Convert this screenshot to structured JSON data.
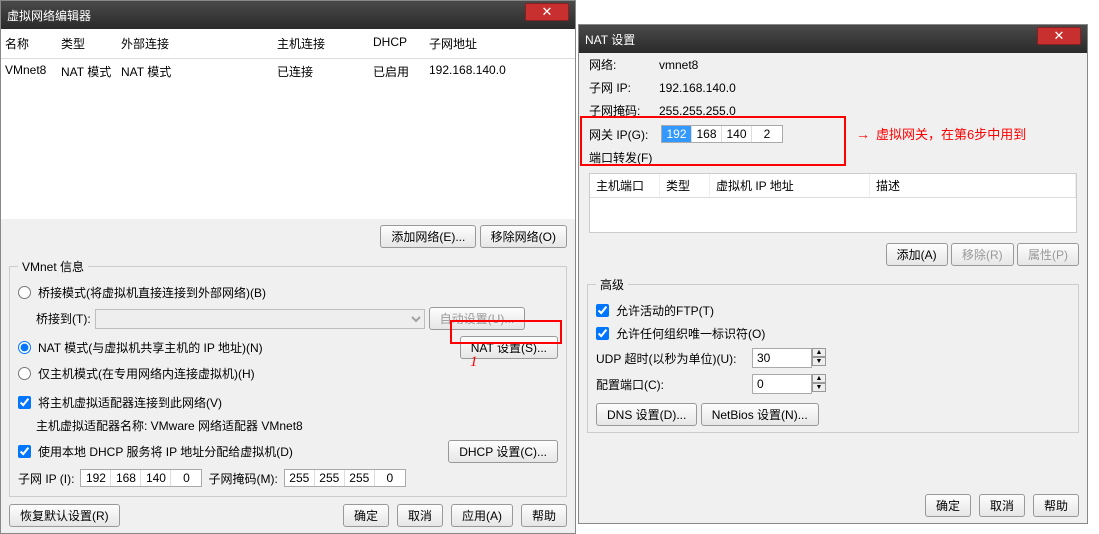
{
  "win1": {
    "title": "虚拟网络编辑器",
    "cols": {
      "name": "名称",
      "type": "类型",
      "ext": "外部连接",
      "host": "主机连接",
      "dhcp": "DHCP",
      "subnet": "子网地址"
    },
    "row": {
      "name": "VMnet8",
      "type": "NAT 模式",
      "ext": "NAT 模式",
      "host": "已连接",
      "dhcp": "已启用",
      "subnet": "192.168.140.0"
    },
    "add_net": "添加网络(E)...",
    "rm_net": "移除网络(O)",
    "vmnet_info": "VMnet 信息",
    "bridge": "桥接模式(将虚拟机直接连接到外部网络)(B)",
    "bridge_to": "桥接到(T):",
    "auto": "自动设置(U)...",
    "nat": "NAT 模式(与虚拟机共享主机的 IP 地址)(N)",
    "nat_set": "NAT 设置(S)...",
    "host_only": "仅主机模式(在专用网络内连接虚拟机)(H)",
    "connect_adapter": "将主机虚拟适配器连接到此网络(V)",
    "adapter_name": "主机虚拟适配器名称: VMware 网络适配器 VMnet8",
    "use_dhcp": "使用本地 DHCP 服务将 IP 地址分配给虚拟机(D)",
    "dhcp_set": "DHCP 设置(C)...",
    "subnet_ip_lbl": "子网 IP (I):",
    "subnet_mask_lbl": "子网掩码(M):",
    "subnet_ip": [
      "192",
      "168",
      "140",
      "0"
    ],
    "subnet_mask": [
      "255",
      "255",
      "255",
      "0"
    ],
    "restore": "恢复默认设置(R)",
    "ok": "确定",
    "cancel": "取消",
    "apply": "应用(A)",
    "help": "帮助"
  },
  "red1": "1",
  "red2": "虚拟网关，在第6步中用到",
  "win2": {
    "title": "NAT 设置",
    "net_lbl": "网络:",
    "net": "vmnet8",
    "sip_lbl": "子网 IP:",
    "sip": "192.168.140.0",
    "smask_lbl": "子网掩码:",
    "smask": "255.255.255.0",
    "gw_lbl": "网关 IP(G):",
    "gw": [
      "192",
      "168",
      "140",
      "2"
    ],
    "pf": "端口转发(F)",
    "pcols": {
      "hp": "主机端口",
      "type": "类型",
      "vip": "虚拟机 IP 地址",
      "desc": "描述"
    },
    "add": "添加(A)",
    "remove": "移除(R)",
    "prop": "属性(P)",
    "adv": "高级",
    "ftp": "允许活动的FTP(T)",
    "org": "允许任何组织唯一标识符(O)",
    "udp_lbl": "UDP 超时(以秒为单位)(U):",
    "udp": "30",
    "cfg_lbl": "配置端口(C):",
    "cfg": "0",
    "dns": "DNS 设置(D)...",
    "netbios": "NetBios 设置(N)...",
    "ok": "确定",
    "cancel": "取消",
    "help": "帮助"
  }
}
